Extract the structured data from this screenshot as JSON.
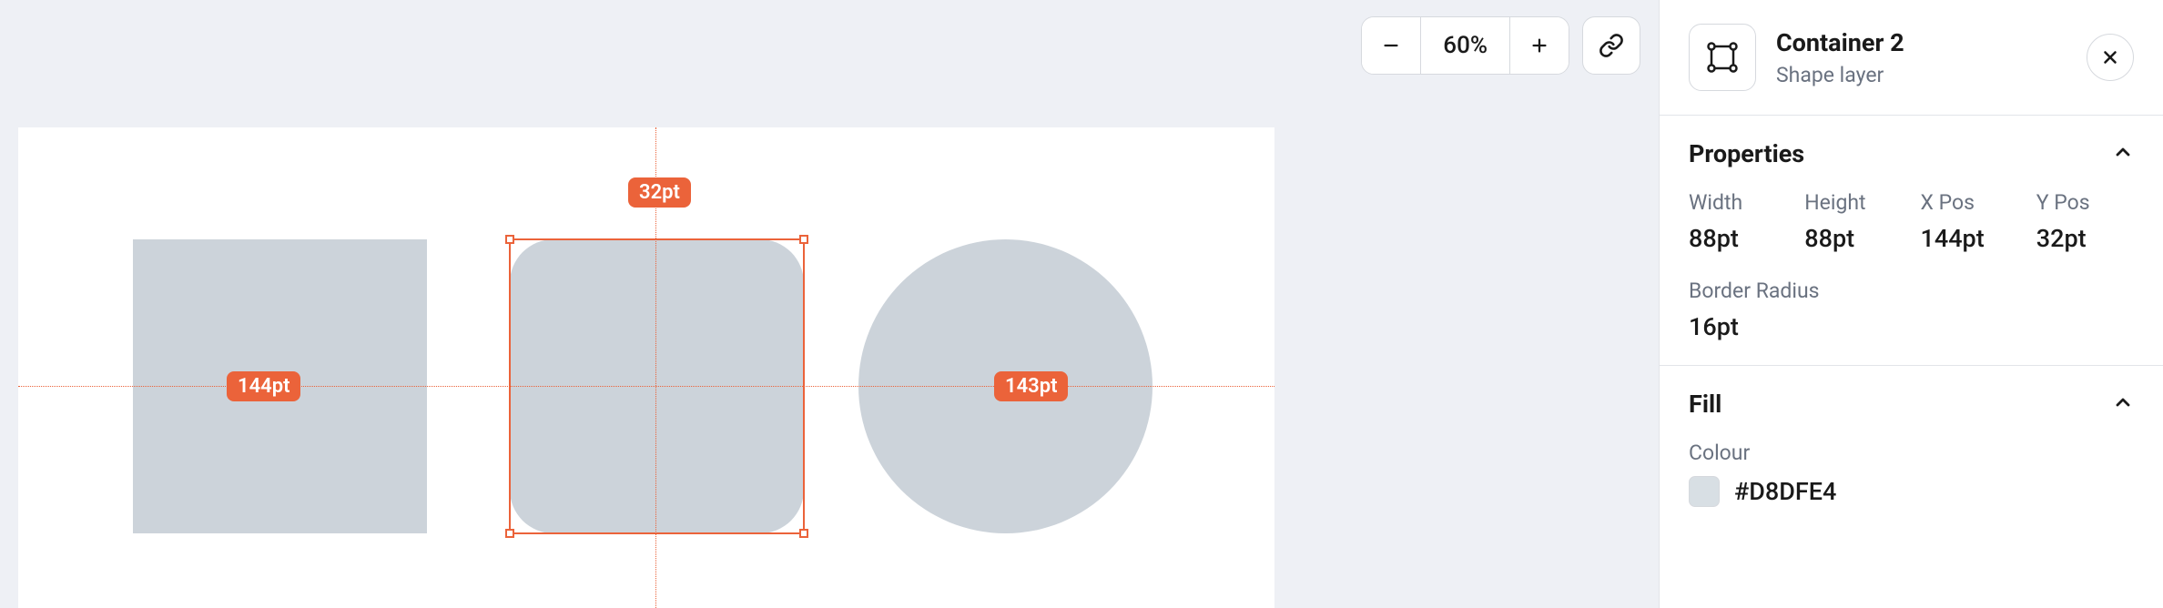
{
  "toolbar": {
    "zoom": {
      "level": "60%",
      "minus_icon": "minus",
      "plus_icon": "plus"
    },
    "link_icon": "link"
  },
  "canvas": {
    "measurements": {
      "top": "32pt",
      "left": "144pt",
      "right": "143pt"
    }
  },
  "inspector": {
    "header": {
      "title": "Container 2",
      "subtitle": "Shape layer",
      "close_icon": "close"
    },
    "sections": {
      "properties": {
        "title": "Properties",
        "items": {
          "width": {
            "label": "Width",
            "value": "88pt"
          },
          "height": {
            "label": "Height",
            "value": "88pt"
          },
          "xpos": {
            "label": "X Pos",
            "value": "144pt"
          },
          "ypos": {
            "label": "Y Pos",
            "value": "32pt"
          },
          "border_radius": {
            "label": "Border Radius",
            "value": "16pt"
          }
        }
      },
      "fill": {
        "title": "Fill",
        "colour_label": "Colour",
        "colour_value": "#D8DFE4"
      }
    }
  },
  "colors": {
    "shape_fill": "#ccd3da",
    "accent": "#eb633a",
    "swatch": "#d8dfe4"
  }
}
